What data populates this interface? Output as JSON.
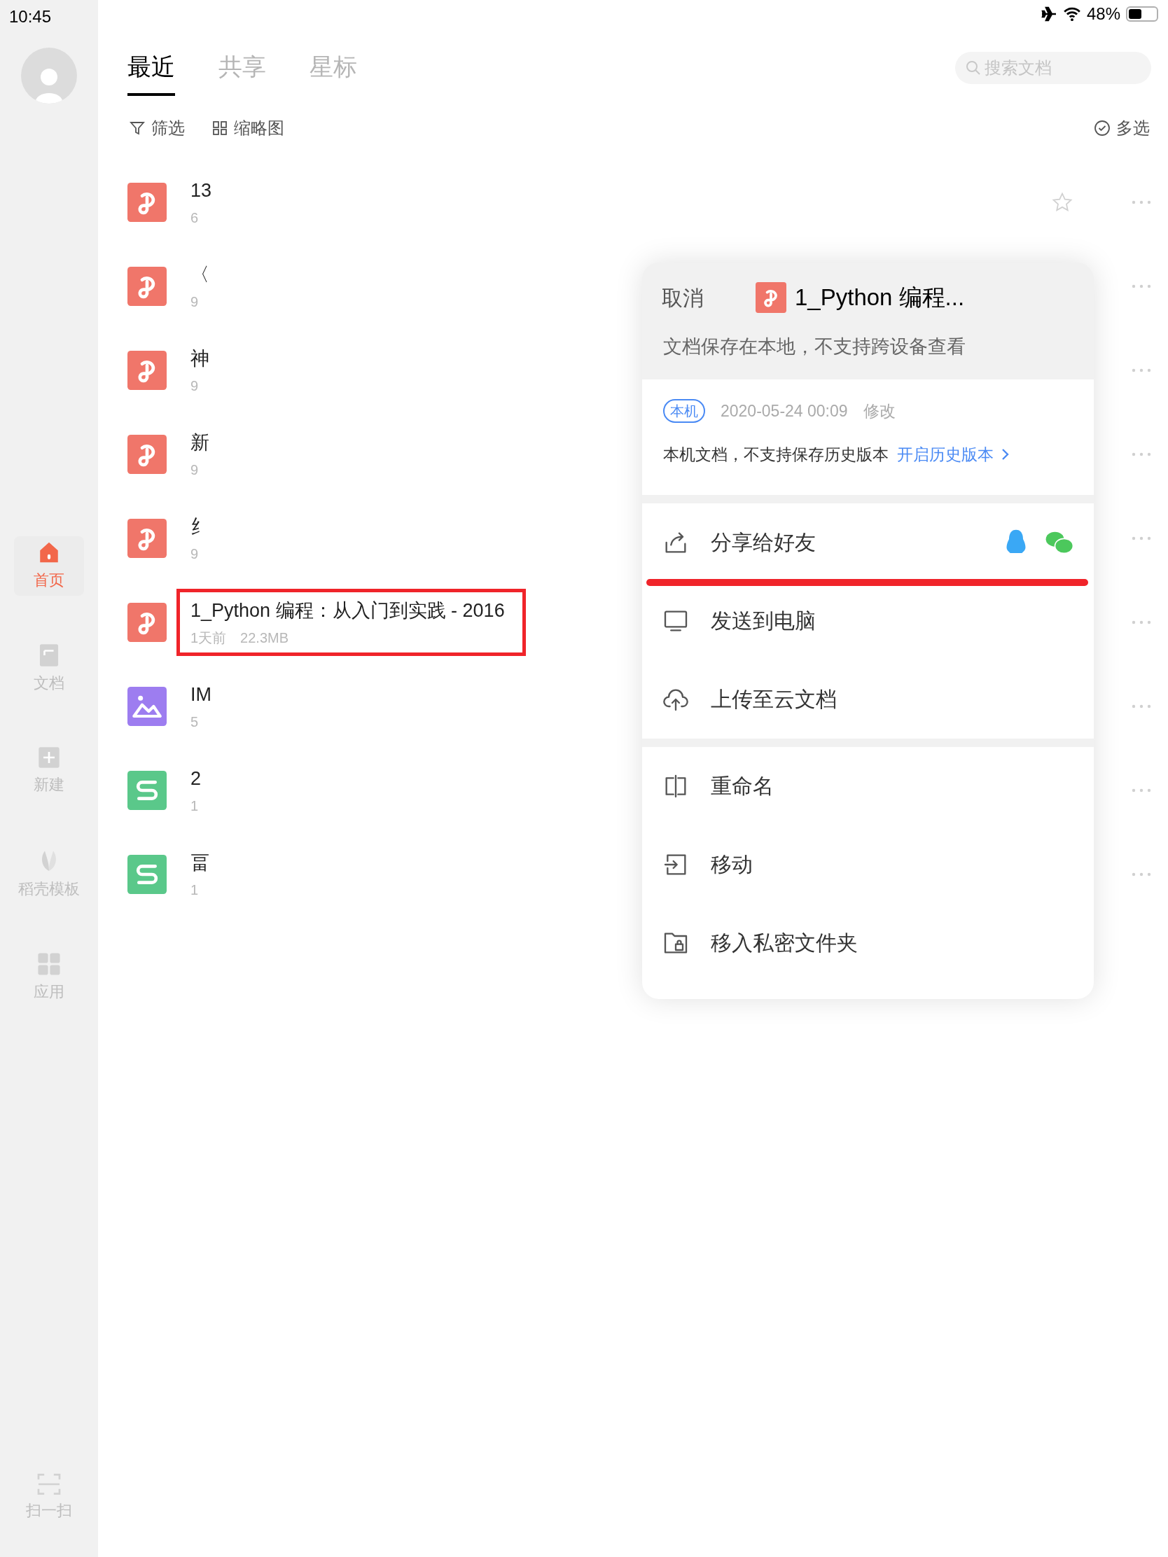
{
  "status_bar": {
    "time": "10:45",
    "battery": "48%"
  },
  "sidebar": {
    "items": [
      {
        "label": "首页",
        "kind": "home",
        "selected": true
      },
      {
        "label": "文档",
        "kind": "doc",
        "selected": false
      },
      {
        "label": "新建",
        "kind": "new",
        "selected": false
      },
      {
        "label": "稻壳模板",
        "kind": "template",
        "selected": false
      },
      {
        "label": "应用",
        "kind": "apps",
        "selected": false
      }
    ],
    "scan": "扫一扫"
  },
  "tabs": [
    {
      "label": "最近",
      "selected": true
    },
    {
      "label": "共享",
      "selected": false
    },
    {
      "label": "星标",
      "selected": false
    }
  ],
  "search": {
    "placeholder": "搜索文档"
  },
  "toolbar": {
    "filter": "筛选",
    "thumbnail": "缩略图",
    "multiselect": "多选"
  },
  "files": [
    {
      "kind": "pdf",
      "title": "13",
      "meta": "6",
      "highlighted": false
    },
    {
      "kind": "pdf",
      "title": "〈",
      "meta": "9",
      "highlighted": false
    },
    {
      "kind": "pdf",
      "title": "神",
      "meta": "9",
      "highlighted": false
    },
    {
      "kind": "pdf",
      "title": "新",
      "meta": "9",
      "highlighted": false
    },
    {
      "kind": "pdf",
      "title": "纟",
      "meta": "9",
      "highlighted": false
    },
    {
      "kind": "pdf",
      "title": "1_Python 编程：从入门到实践 - 2016",
      "meta": "1天前　22.3MB",
      "highlighted": true
    },
    {
      "kind": "image",
      "title": "IM",
      "meta": "5",
      "highlighted": false
    },
    {
      "kind": "sheet",
      "title": "2",
      "meta": "1",
      "highlighted": false
    },
    {
      "kind": "sheet",
      "title": "畐",
      "meta": "1",
      "highlighted": false
    }
  ],
  "panel": {
    "cancel": "取消",
    "title": "1_Python 编程...",
    "notice": "文档保存在本地，不支持跨设备查看",
    "info": {
      "tag": "本机",
      "date": "2020-05-24 00:09",
      "action": "修改",
      "history_note": "本机文档，不支持保存历史版本",
      "history_link": "开启历史版本"
    },
    "groups": [
      [
        {
          "kind": "share",
          "label": "分享给好友",
          "annotated": true
        },
        {
          "kind": "computer",
          "label": "发送到电脑",
          "annotated": false
        },
        {
          "kind": "cloud",
          "label": "上传至云文档",
          "annotated": false
        }
      ],
      [
        {
          "kind": "rename",
          "label": "重命名",
          "annotated": false
        },
        {
          "kind": "move",
          "label": "移动",
          "annotated": false
        },
        {
          "kind": "private",
          "label": "移入私密文件夹",
          "annotated": false
        }
      ]
    ]
  }
}
